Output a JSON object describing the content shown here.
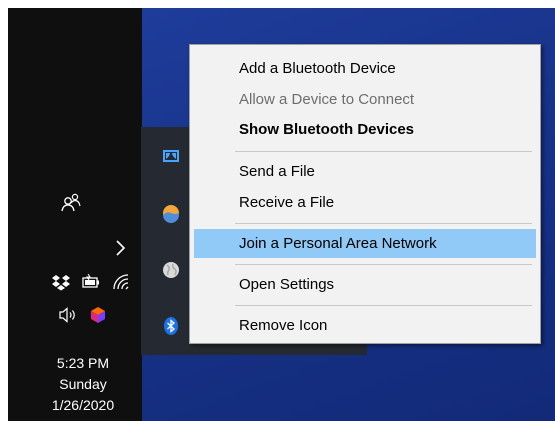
{
  "taskbar": {
    "icons": [
      "people-icon",
      "show-hidden-icons-chevron",
      "dropbox-icon",
      "battery-icon",
      "wifi-icon",
      "volume-icon",
      "app-cube-icon"
    ]
  },
  "clock": {
    "time": "5:23 PM",
    "day": "Sunday",
    "date": "1/26/2020"
  },
  "overflow_icons": [
    "dolby-icon",
    "weather-icon",
    "globe-icon",
    "bluetooth-icon"
  ],
  "context_menu": {
    "items": [
      {
        "label": "Add a Bluetooth Device",
        "state": "normal"
      },
      {
        "label": "Allow a Device to Connect",
        "state": "disabled"
      },
      {
        "label": "Show Bluetooth Devices",
        "state": "bold"
      },
      {
        "label": "Send a File",
        "state": "normal"
      },
      {
        "label": "Receive a File",
        "state": "normal"
      },
      {
        "label": "Join a Personal Area Network",
        "state": "highlighted"
      },
      {
        "label": "Open Settings",
        "state": "normal"
      },
      {
        "label": "Remove Icon",
        "state": "normal"
      }
    ]
  },
  "colors": {
    "desktop": "#173288",
    "taskbar": "#0f0f0f",
    "menu_bg": "#f2f2f2",
    "highlight": "#91c9f7",
    "bluetooth": "#1a73e8"
  }
}
